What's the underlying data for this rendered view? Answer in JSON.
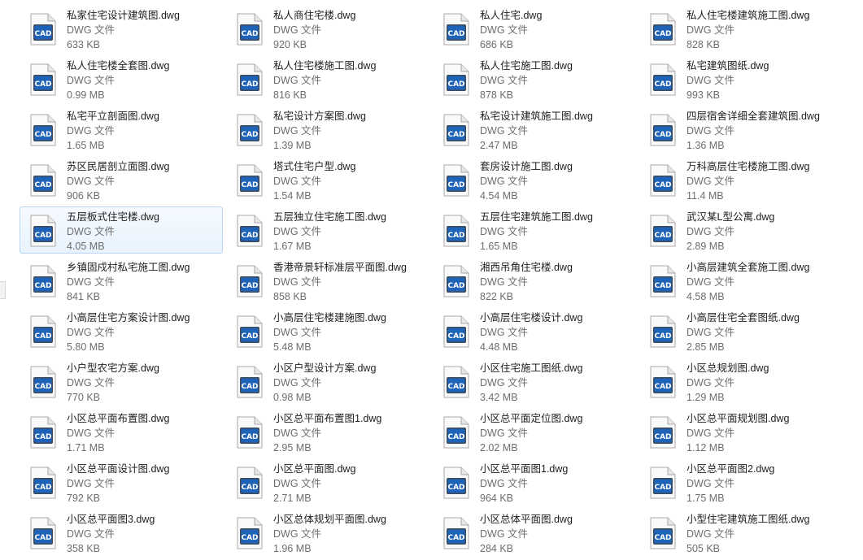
{
  "file_type_label": "DWG 文件",
  "icon": "cad-file-icon",
  "accent_selection": "#cce4f7",
  "selected_index": 16,
  "items": [
    {
      "name": "私家住宅设计建筑图.dwg",
      "type": "DWG 文件",
      "size": "633 KB"
    },
    {
      "name": "私人商住宅楼.dwg",
      "type": "DWG 文件",
      "size": "920 KB"
    },
    {
      "name": "私人住宅.dwg",
      "type": "DWG 文件",
      "size": "686 KB"
    },
    {
      "name": "私人住宅楼建筑施工图.dwg",
      "type": "DWG 文件",
      "size": "828 KB"
    },
    {
      "name": "私人住宅楼全套图.dwg",
      "type": "DWG 文件",
      "size": "0.99 MB"
    },
    {
      "name": "私人住宅楼施工图.dwg",
      "type": "DWG 文件",
      "size": "816 KB"
    },
    {
      "name": "私人住宅施工图.dwg",
      "type": "DWG 文件",
      "size": "878 KB"
    },
    {
      "name": "私宅建筑图纸.dwg",
      "type": "DWG 文件",
      "size": "993 KB"
    },
    {
      "name": "私宅平立剖面图.dwg",
      "type": "DWG 文件",
      "size": "1.65 MB"
    },
    {
      "name": "私宅设计方案图.dwg",
      "type": "DWG 文件",
      "size": "1.39 MB"
    },
    {
      "name": "私宅设计建筑施工图.dwg",
      "type": "DWG 文件",
      "size": "2.47 MB"
    },
    {
      "name": "四层宿舍详细全套建筑图.dwg",
      "type": "DWG 文件",
      "size": "1.36 MB"
    },
    {
      "name": "苏区民居剖立面图.dwg",
      "type": "DWG 文件",
      "size": "906 KB"
    },
    {
      "name": "塔式住宅户型.dwg",
      "type": "DWG 文件",
      "size": "1.54 MB"
    },
    {
      "name": "套房设计施工图.dwg",
      "type": "DWG 文件",
      "size": "4.54 MB"
    },
    {
      "name": "万科高层住宅楼施工图.dwg",
      "type": "DWG 文件",
      "size": "11.4 MB"
    },
    {
      "name": "五层板式住宅楼.dwg",
      "type": "DWG 文件",
      "size": "4.05 MB"
    },
    {
      "name": "五层独立住宅施工图.dwg",
      "type": "DWG 文件",
      "size": "1.67 MB"
    },
    {
      "name": "五层住宅建筑施工图.dwg",
      "type": "DWG 文件",
      "size": "1.65 MB"
    },
    {
      "name": "武汉某L型公寓.dwg",
      "type": "DWG 文件",
      "size": "2.89 MB"
    },
    {
      "name": "乡镇固戍村私宅施工图.dwg",
      "type": "DWG 文件",
      "size": "841 KB"
    },
    {
      "name": "香港帝景轩标准层平面图.dwg",
      "type": "DWG 文件",
      "size": "858 KB"
    },
    {
      "name": "湘西吊角住宅楼.dwg",
      "type": "DWG 文件",
      "size": "822 KB"
    },
    {
      "name": "小高层建筑全套施工图.dwg",
      "type": "DWG 文件",
      "size": "4.58 MB"
    },
    {
      "name": "小高层住宅方案设计图.dwg",
      "type": "DWG 文件",
      "size": "5.80 MB"
    },
    {
      "name": "小高层住宅楼建施图.dwg",
      "type": "DWG 文件",
      "size": "5.48 MB"
    },
    {
      "name": "小高层住宅楼设计.dwg",
      "type": "DWG 文件",
      "size": "4.48 MB"
    },
    {
      "name": "小高层住宅全套图纸.dwg",
      "type": "DWG 文件",
      "size": "2.85 MB"
    },
    {
      "name": "小户型农宅方案.dwg",
      "type": "DWG 文件",
      "size": "770 KB"
    },
    {
      "name": "小区户型设计方案.dwg",
      "type": "DWG 文件",
      "size": "0.98 MB"
    },
    {
      "name": "小区住宅施工图纸.dwg",
      "type": "DWG 文件",
      "size": "3.42 MB"
    },
    {
      "name": "小区总规划图.dwg",
      "type": "DWG 文件",
      "size": "1.29 MB"
    },
    {
      "name": "小区总平面布置图.dwg",
      "type": "DWG 文件",
      "size": "1.71 MB"
    },
    {
      "name": "小区总平面布置图1.dwg",
      "type": "DWG 文件",
      "size": "2.95 MB"
    },
    {
      "name": "小区总平面定位图.dwg",
      "type": "DWG 文件",
      "size": "2.02 MB"
    },
    {
      "name": "小区总平面规划图.dwg",
      "type": "DWG 文件",
      "size": "1.12 MB"
    },
    {
      "name": "小区总平面设计图.dwg",
      "type": "DWG 文件",
      "size": "792 KB"
    },
    {
      "name": "小区总平面图.dwg",
      "type": "DWG 文件",
      "size": "2.71 MB"
    },
    {
      "name": "小区总平面图1.dwg",
      "type": "DWG 文件",
      "size": "964 KB"
    },
    {
      "name": "小区总平面图2.dwg",
      "type": "DWG 文件",
      "size": "1.75 MB"
    },
    {
      "name": "小区总平面图3.dwg",
      "type": "DWG 文件",
      "size": "358 KB"
    },
    {
      "name": "小区总体规划平面图.dwg",
      "type": "DWG 文件",
      "size": "1.96 MB"
    },
    {
      "name": "小区总体平面图.dwg",
      "type": "DWG 文件",
      "size": "284 KB"
    },
    {
      "name": "小型住宅建筑施工图纸.dwg",
      "type": "DWG 文件",
      "size": "505 KB"
    }
  ]
}
